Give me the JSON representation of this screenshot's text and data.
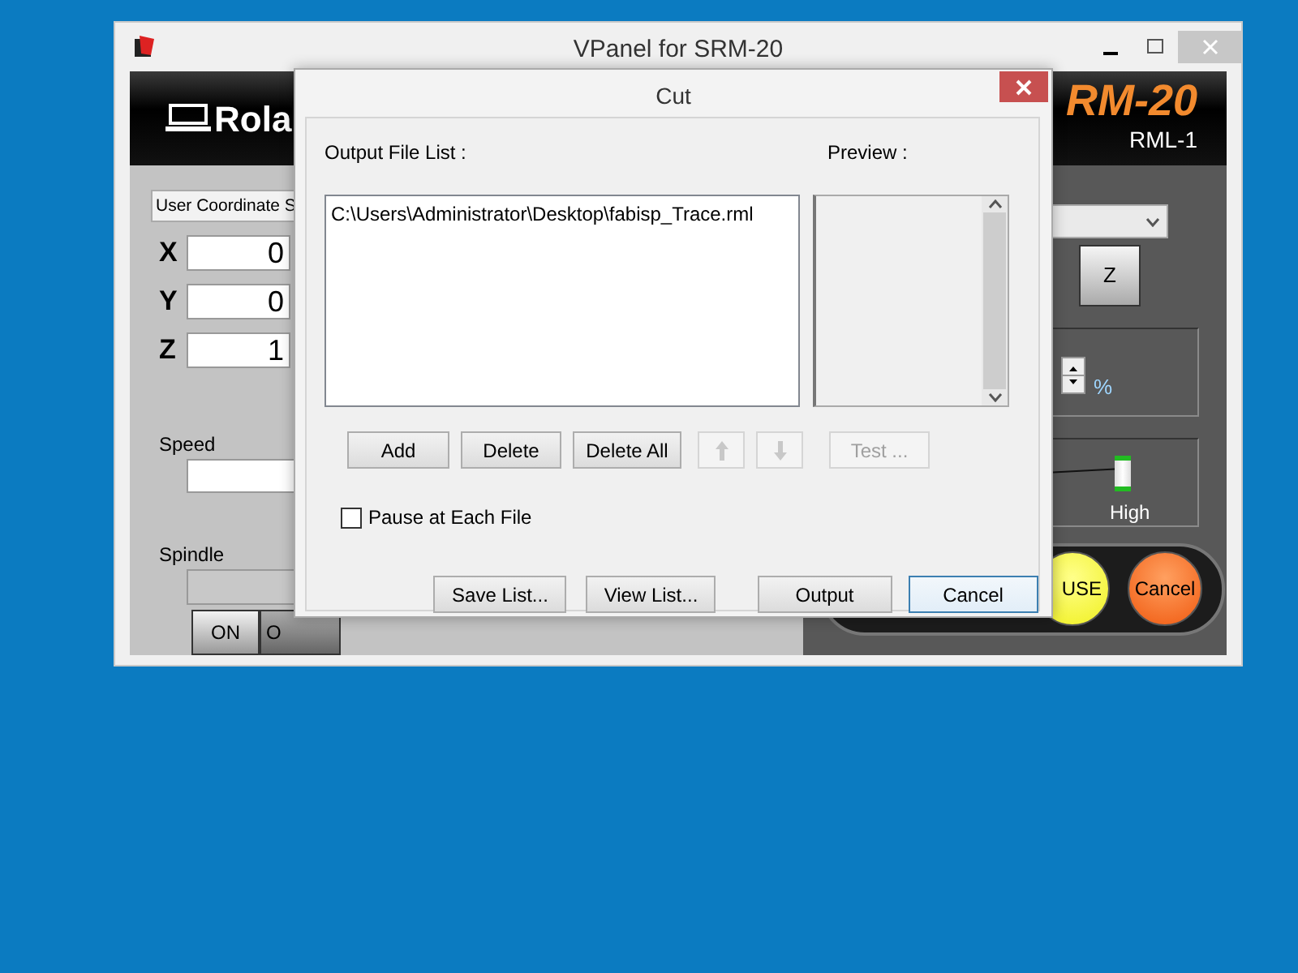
{
  "main_window": {
    "title": "VPanel for SRM-20",
    "logo": "Rola",
    "model": "RM-20",
    "model_sub": "RML-1",
    "coordinate_select": "User Coordinate S",
    "axes": [
      {
        "label": "X",
        "value": "0"
      },
      {
        "label": "Y",
        "value": "0"
      },
      {
        "label": "Z",
        "value": "1"
      }
    ],
    "speed_label": "Speed",
    "spindle_label": "Spindle",
    "spindle_buttons": [
      "ON",
      "O"
    ],
    "move_button": "Z",
    "percent": "%",
    "slider": {
      "label": "High",
      "level": 1
    },
    "pause_button": "USE",
    "cancel_button": "Cancel"
  },
  "dialog": {
    "title": "Cut",
    "list_label": "Output File List :",
    "preview_label": "Preview :",
    "files": [
      {
        "path": "C:\\Users\\Administrator\\Desktop\\fabisp_Trace.rml"
      }
    ],
    "buttons": [
      {
        "kind": "text",
        "label": "Add",
        "disabled": false
      },
      {
        "kind": "text",
        "label": "Delete",
        "disabled": false
      },
      {
        "kind": "text",
        "label": "Delete All",
        "disabled": false
      },
      {
        "kind": "up",
        "disabled": true
      },
      {
        "kind": "down",
        "disabled": true
      },
      {
        "kind": "text",
        "label": "Test ...",
        "disabled": true
      }
    ],
    "pause_each_file": {
      "label": "Pause at Each File",
      "checked": false
    },
    "footer_buttons": [
      {
        "label": "Save List...",
        "focused": false
      },
      {
        "label": "View List...",
        "focused": false
      },
      {
        "label": "Output",
        "focused": false
      },
      {
        "label": "Cancel",
        "focused": true
      }
    ]
  }
}
